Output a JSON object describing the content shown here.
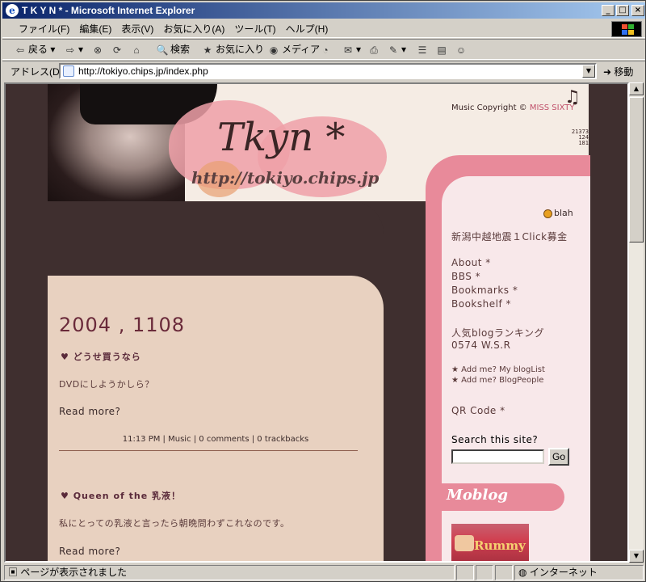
{
  "window": {
    "title": "T K Y N * - Microsoft Internet Explorer",
    "minimize_label": "_",
    "maximize_label": "□",
    "close_label": "×"
  },
  "menu": [
    "ファイル(F)",
    "編集(E)",
    "表示(V)",
    "お気に入り(A)",
    "ツール(T)",
    "ヘルプ(H)"
  ],
  "toolbar": {
    "back": "戻る",
    "search": "検索",
    "favorites": "お気に入り",
    "media": "メディア"
  },
  "address": {
    "label": "アドレス(D)",
    "url": "http://tokiyo.chips.jp/index.php",
    "go": "移動"
  },
  "header": {
    "logo": "Tkyn *",
    "logo_url": "http://tokiyo.chips.jp",
    "music_prefix": "Music Copyright © ",
    "music_link": "MISS SIXTY",
    "counter": [
      "21373",
      "124",
      "181"
    ]
  },
  "posts": {
    "date": "2004 , 1108",
    "items": [
      {
        "title": "♥ どうせ買うなら",
        "text": "DVDにしようかしら？",
        "read_more": "Read more?",
        "time": "11:13 PM",
        "category": "Music",
        "comments": "0 comments",
        "trackbacks": "0 trackbacks"
      },
      {
        "title": "♥ Queen of the 乳液！",
        "text": "私にとっての乳液と言ったら朝晩問わずこれなのです。",
        "read_more": "Read more?"
      }
    ],
    "separator": " | "
  },
  "sidebar": {
    "blah": "blah",
    "quake": "新潟中越地震１Click募金",
    "nav": [
      "About *",
      "BBS *",
      "Bookmarks *",
      "Bookshelf *"
    ],
    "ranking": [
      "人気blogランキング",
      "0574 W.S.R"
    ],
    "add_me": [
      "★ Add me? My blogList",
      "★ Add me? BlogPeople"
    ],
    "qr": "QR Code *",
    "search_label": "Search this site?",
    "search_button": "Go",
    "moblog": "Moblog",
    "mob_image_text": "Rummy"
  },
  "status": {
    "text": "ページが表示されました",
    "zone": "インターネット"
  }
}
